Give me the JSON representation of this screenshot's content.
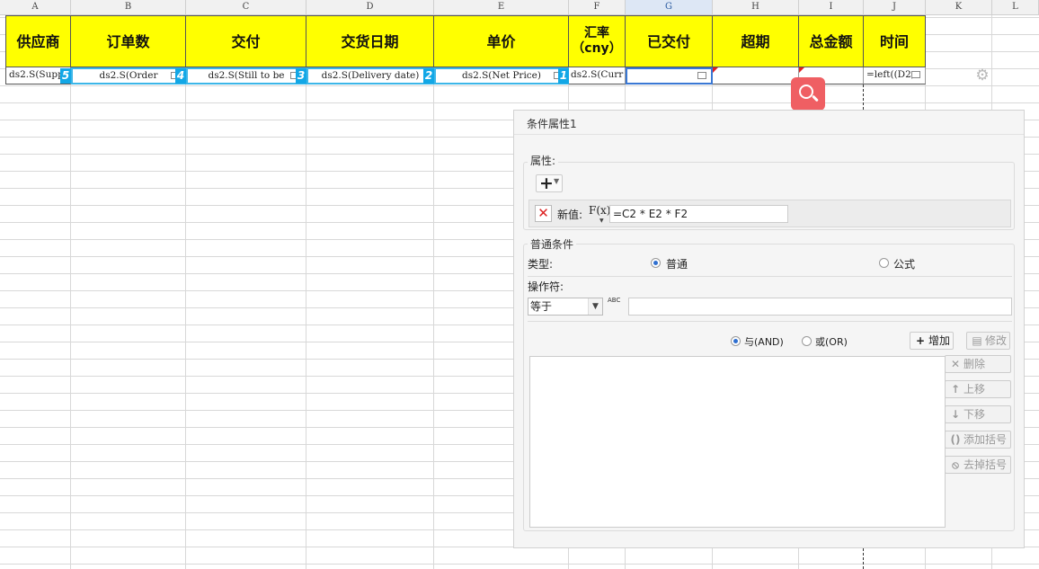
{
  "sheet": {
    "columns": [
      "A",
      "B",
      "C",
      "D",
      "E",
      "F",
      "G",
      "H",
      "I",
      "J",
      "K",
      "L"
    ],
    "selected_column": "G",
    "header_row": [
      "供应商",
      "订单数",
      "交付",
      "交货日期",
      "单价",
      "汇率\n（cny）",
      "已交付",
      "超期",
      "总金额",
      "时间"
    ],
    "data_row": [
      "ds2.S(Supp",
      "ds2.S(Order",
      "ds2.S(Still to be",
      "ds2.S(Delivery date)",
      "ds2.S(Net Price)",
      "ds2.S(Curr",
      "",
      "",
      "",
      "=left((D2,"
    ],
    "badges": [
      "5",
      "4",
      "3",
      "2",
      "1"
    ]
  },
  "panel": {
    "title": "条件属性1",
    "attr_label": "属性:",
    "new_value_label": "新值:",
    "fx_label": "F(x)",
    "formula": "=C2 * E2 * F2",
    "common_cond_label": "普通条件",
    "type_label": "类型:",
    "type_options": [
      "普通",
      "公式"
    ],
    "operator_label": "操作符:",
    "operator_value": "等于",
    "operator_arrow": "▼",
    "abc_label": "ABC",
    "logic_options": [
      "与(AND)",
      "或(OR)"
    ],
    "buttons": {
      "add": "增加",
      "modify": "修改",
      "delete": "删除",
      "move_up": "上移",
      "move_down": "下移",
      "add_bracket": "添加括号",
      "remove_bracket": "去掉括号"
    }
  },
  "colors": {
    "header_fill": "#ffff00",
    "binding_border": "#3cb6e8",
    "badge": "#12a7e6",
    "search_button": "#ef5f63",
    "delete_x": "#dd2222"
  }
}
